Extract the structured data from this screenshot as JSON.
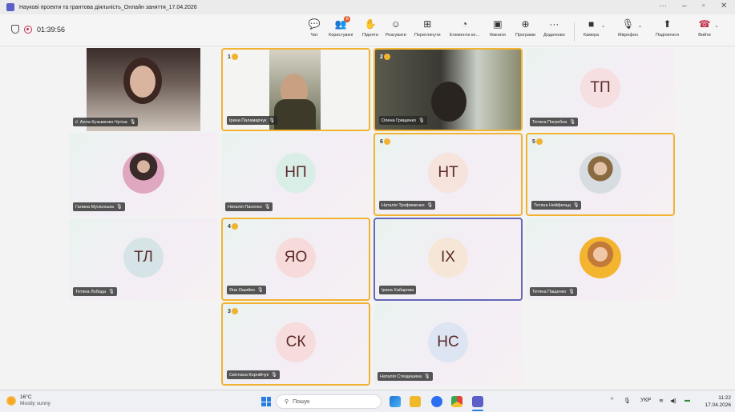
{
  "window": {
    "title": "Наукові проекти та грантова діяльність_Онлайн заняття_17.04.2026"
  },
  "meeting": {
    "timer": "01:39:56"
  },
  "toolbar": {
    "chat": "Чат",
    "people": "Користувачі",
    "people_badge": "6",
    "raise": "Підняти",
    "react": "Реагувати",
    "view": "Переглянути",
    "copilot": "Елементи ке...",
    "rooms": "Кімнати",
    "apps": "Програми",
    "more": "Додатково",
    "camera": "Камера",
    "mic": "Мікрофон",
    "share": "Поділитися",
    "leave": "Вийти"
  },
  "participants": [
    {
      "name": "Алла Кузьменко-Чугіна",
      "kind": "video",
      "speaking": false
    },
    {
      "name": "Ірина Паламарчук",
      "kind": "video",
      "hand": "1",
      "speaking": true
    },
    {
      "name": "Олена Грищенко",
      "kind": "video",
      "hand": "2",
      "speaking": true
    },
    {
      "name": "Тетяна Погребна",
      "kind": "initials",
      "initials": "ТП",
      "color": "#f6dfe0"
    },
    {
      "name": "Галина Мусієнська",
      "kind": "photo",
      "speaking": false
    },
    {
      "name": "Наталія Пасенко",
      "kind": "initials",
      "initials": "НП",
      "color": "#d9eee6"
    },
    {
      "name": "Наталія Трофименко",
      "kind": "initials",
      "initials": "НТ",
      "hand": "6",
      "color": "#f5e3dc",
      "speaking": true
    },
    {
      "name": "Тетяна Нейфельд",
      "kind": "photo",
      "hand": "5",
      "speaking": true
    },
    {
      "name": "Тетяна Лобода",
      "kind": "initials",
      "initials": "ТЛ",
      "color": "#d6e3e7"
    },
    {
      "name": "Яна Ошийко",
      "kind": "initials",
      "initials": "ЯО",
      "hand": "4",
      "color": "#f7dada",
      "speaking": true
    },
    {
      "name": "Ірина Хабарова",
      "kind": "initials",
      "initials": "ІХ",
      "color": "#f6e6d8",
      "pinned": true
    },
    {
      "name": "Тетяна Пащенко",
      "kind": "photo"
    },
    {
      "name": "Світлана Корнійчук",
      "kind": "initials",
      "initials": "СК",
      "hand": "3",
      "color": "#f6dcdc",
      "speaking": true
    },
    {
      "name": "Наталія Стещишина",
      "kind": "initials",
      "initials": "НС",
      "color": "#dde4f2"
    }
  ],
  "taskbar": {
    "temp": "16°C",
    "weather": "Mostly sunny",
    "search_placeholder": "Пошук",
    "lang": "УКР",
    "time": "11:22",
    "date": "17.04.2026"
  }
}
